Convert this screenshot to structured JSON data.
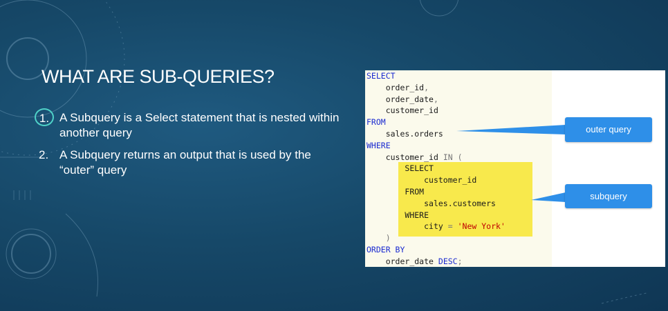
{
  "slide": {
    "title": "WHAT ARE SUB-QUERIES?",
    "bullets": [
      {
        "number": "1.",
        "text": "A Subquery is a Select statement that is nested within another query"
      },
      {
        "number": "2.",
        "text": "A Subquery returns an output that is used by the “outer” query"
      }
    ]
  },
  "code": {
    "select_kw": "SELECT",
    "col1": "order_id",
    "col2": "order_date",
    "col3": "customer_id",
    "from_kw": "FROM",
    "table": "sales.orders",
    "where_kw": "WHERE",
    "filter_col": "customer_id",
    "in_kw": "IN",
    "sub_select_kw": "SELECT",
    "sub_col": "customer_id",
    "sub_from_kw": "FROM",
    "sub_table": "sales.customers",
    "sub_where_kw": "WHERE",
    "sub_filter_col": "city",
    "sub_value": "'New York'",
    "order_kw": "ORDER BY",
    "order_col": "order_date",
    "desc_kw": "DESC"
  },
  "callouts": {
    "outer": "outer query",
    "sub": "subquery"
  },
  "colors": {
    "background": "#164868",
    "accent_circle": "#4fd2c8",
    "callout": "#2e8fe8",
    "highlight": "#f8e94c",
    "keyword": "#1a2ad0",
    "string": "#c00000"
  }
}
